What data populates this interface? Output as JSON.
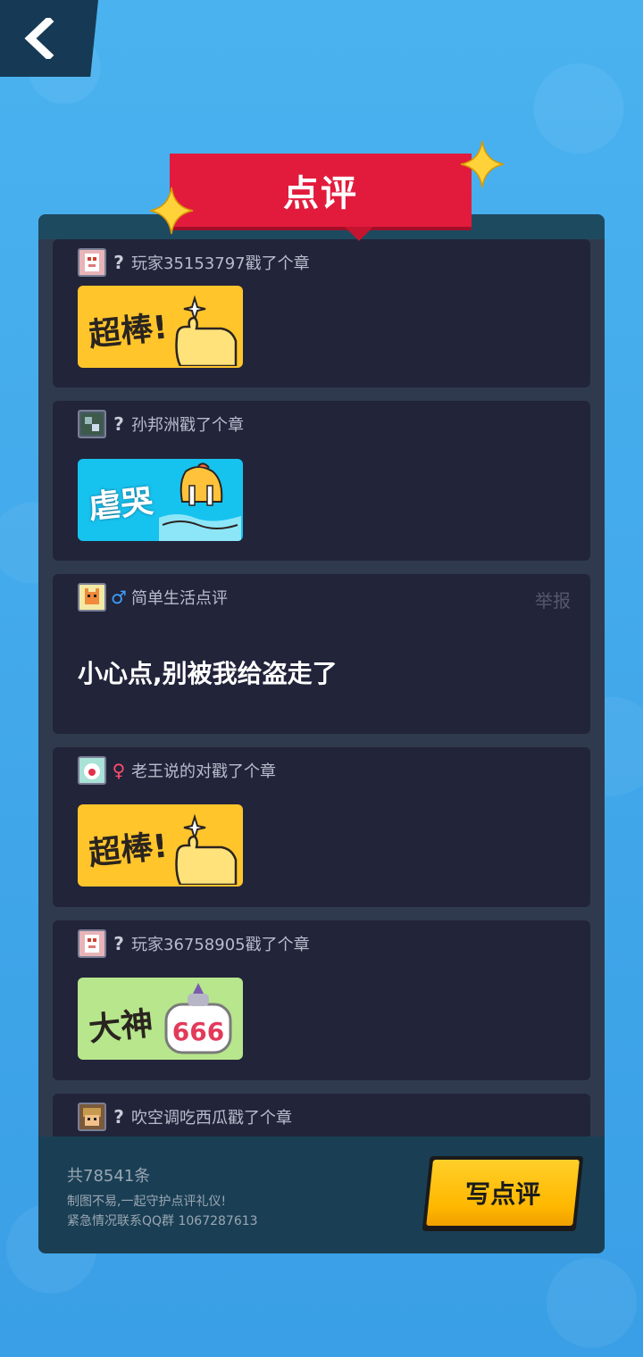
{
  "header": {
    "back_icon": "chevron-left-icon",
    "title": "点评"
  },
  "comments": [
    {
      "avatar_icon": "avatar-pixel-fox",
      "gender": "?",
      "gender_type": "unknown",
      "username": "玩家35153797戳了个章",
      "sticker": {
        "text": "超棒!",
        "style": "thumbs-up",
        "bg": "#ffc52b"
      }
    },
    {
      "avatar_icon": "avatar-pixel-map",
      "gender": "?",
      "gender_type": "unknown",
      "username": "孙邦洲戳了个章",
      "sticker": {
        "text": "虐哭",
        "style": "crying",
        "bg": "#16c3ef"
      }
    },
    {
      "avatar_icon": "avatar-pixel-cat",
      "gender": "♂",
      "gender_type": "male",
      "username": "简单生活点评",
      "report": "举报",
      "text": "小心点,别被我给盗走了"
    },
    {
      "avatar_icon": "avatar-pixel-face",
      "gender": "♀",
      "gender_type": "female",
      "username": "老王说的对戳了个章",
      "sticker": {
        "text": "超棒!",
        "style": "thumbs-up",
        "bg": "#ffc52b"
      }
    },
    {
      "avatar_icon": "avatar-pixel-fox",
      "gender": "?",
      "gender_type": "unknown",
      "username": "玩家36758905戳了个章",
      "sticker": {
        "text": "大神",
        "extra": "666",
        "style": "god",
        "bg": "#b7e68c"
      }
    },
    {
      "avatar_icon": "avatar-pixel-warrior",
      "gender": "?",
      "gender_type": "unknown",
      "username": "吹空调吃西瓜戳了个章"
    }
  ],
  "footer": {
    "count": "共78541条",
    "note_line1": "制图不易,一起守护点评礼仪!",
    "note_line2": "紧急情况联系QQ群 1067287613",
    "write_button": "写点评"
  },
  "colors": {
    "background": "#3fa6ea",
    "panel": "#2f3a4e",
    "card": "#22243a",
    "ribbon": "#e21b3c",
    "button": "#ffc000"
  }
}
